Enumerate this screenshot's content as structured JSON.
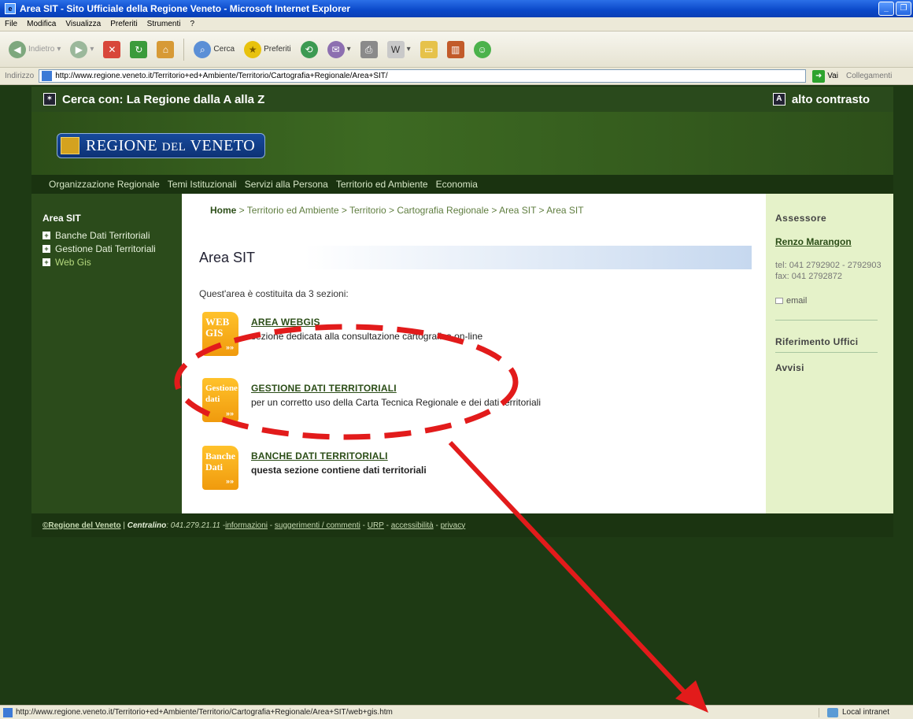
{
  "window": {
    "title": "Area SIT - Sito Ufficiale della Regione Veneto - Microsoft Internet Explorer"
  },
  "menu": [
    "File",
    "Modifica",
    "Visualizza",
    "Preferiti",
    "Strumenti",
    "?"
  ],
  "toolbar": {
    "back": "Indietro",
    "search": "Cerca",
    "favorites": "Preferiti"
  },
  "address": {
    "label": "Indirizzo",
    "url": "http://www.regione.veneto.it/Territorio+ed+Ambiente/Territorio/Cartografia+Regionale/Area+SIT/",
    "go": "Vai",
    "links": "Collegamenti"
  },
  "top": {
    "search_with": "Cerca con: La Regione dalla A alla Z",
    "contrast": "alto contrasto"
  },
  "logo": {
    "part1": "REGIONE ",
    "part2": "DEL",
    "part3": " VENETO"
  },
  "nav": [
    "Organizzazione Regionale",
    "Temi Istituzionali",
    "Servizi alla Persona",
    "Territorio ed Ambiente",
    "Economia"
  ],
  "sidebar": {
    "title": "Area SIT",
    "items": [
      {
        "label": "Banche Dati Territoriali"
      },
      {
        "label": "Gestione Dati Territoriali"
      },
      {
        "label": "Web Gis"
      }
    ]
  },
  "breadcrumb": {
    "home": "Home",
    "rest": " > Territorio ed Ambiente > Territorio > Cartografia Regionale > Area SIT > Area SIT"
  },
  "main": {
    "title": "Area SIT",
    "intro": "Quest'area è costituita da 3 sezioni:",
    "entries": [
      {
        "badge1": "WEB",
        "badge2": "GIS",
        "title": "AREA WEBGIS",
        "desc": "sezione dedicata alla consultazione cartografica on-line"
      },
      {
        "badge1": "Gestione",
        "badge2": "dati",
        "title": "GESTIONE DATI TERRITORIALI",
        "desc": "per un corretto uso della Carta Tecnica Regionale e dei dati territoriali"
      },
      {
        "badge1": "Banche",
        "badge2": "Dati",
        "title": "BANCHE DATI TERRITORIALI",
        "desc": "questa sezione contiene dati territoriali"
      }
    ],
    "badge_arrows": "»»"
  },
  "right": {
    "assessore_label": "Assessore",
    "name": "Renzo Marangon",
    "phone": "tel: 041 2792902 - 2792903",
    "fax": "fax: 041 2792872",
    "email": "email",
    "offices": "Riferimento Uffici",
    "notices": "Avvisi"
  },
  "footer": {
    "copyright": "©Regione del Veneto",
    "centralino_label": "Centralino",
    "centralino": ": 041.279.21.11 - ",
    "links": [
      "informazioni",
      "suggerimenti / commenti",
      "URP",
      "accessibilità",
      "privacy"
    ]
  },
  "status": {
    "url": "http://www.regione.veneto.it/Territorio+ed+Ambiente/Territorio/Cartografia+Regionale/Area+SIT/web+gis.htm",
    "zone": "Local intranet"
  },
  "colors": {
    "annotation": "#e21b1b",
    "accent_green": "#2c4e18",
    "title_blue": "#0a48c8"
  }
}
